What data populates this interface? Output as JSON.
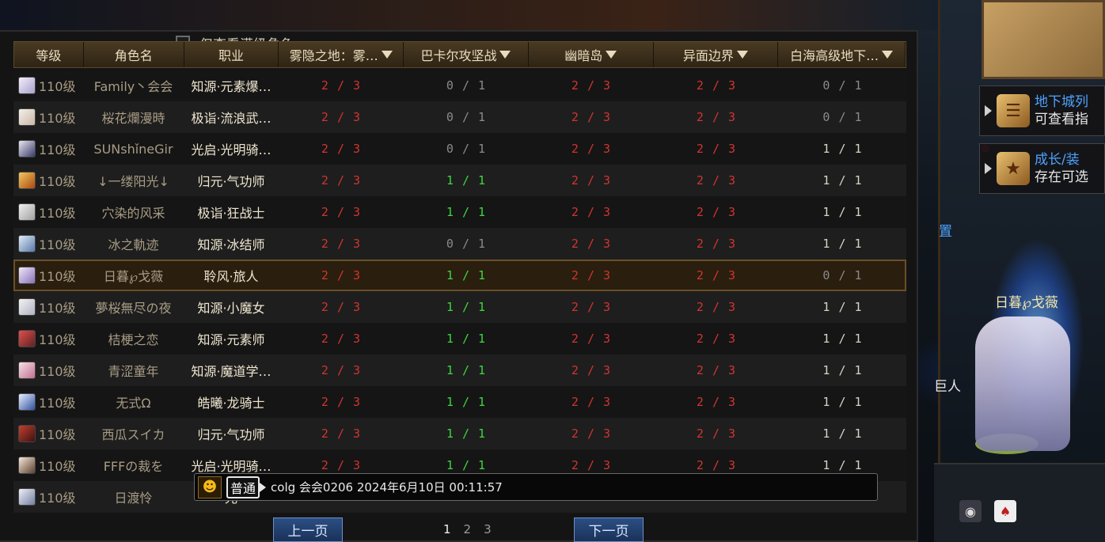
{
  "filter": {
    "label": "仅查看满级角色"
  },
  "columns": {
    "level": "等级",
    "name": "角色名",
    "job": "职业",
    "d1": "雾隐之地：雾…",
    "d2": "巴卡尔攻坚战",
    "d3": "幽暗岛",
    "d4": "异面边界",
    "d5": "白海高级地下…"
  },
  "rows": [
    {
      "level": "110级",
      "name": "Family丶会会",
      "job": "知源·元素爆…",
      "d1": "2 / 3",
      "d2": "0 / 1",
      "d3": "2 / 3",
      "d4": "2 / 3",
      "d5": "0 / 1"
    },
    {
      "level": "110级",
      "name": "桜花爛漫時",
      "job": "极诣·流浪武…",
      "d1": "2 / 3",
      "d2": "0 / 1",
      "d3": "2 / 3",
      "d4": "2 / 3",
      "d5": "0 / 1"
    },
    {
      "level": "110级",
      "name": "SUNshǐneGir",
      "job": "光启·光明骑…",
      "d1": "2 / 3",
      "d2": "0 / 1",
      "d3": "2 / 3",
      "d4": "2 / 3",
      "d5": "1 / 1"
    },
    {
      "level": "110级",
      "name": "↓一缕阳光↓",
      "job": "归元·气功师",
      "d1": "2 / 3",
      "d2": "1 / 1",
      "d3": "2 / 3",
      "d4": "2 / 3",
      "d5": "1 / 1"
    },
    {
      "level": "110级",
      "name": "穴染的风采",
      "job": "极诣·狂战士",
      "d1": "2 / 3",
      "d2": "1 / 1",
      "d3": "2 / 3",
      "d4": "2 / 3",
      "d5": "1 / 1"
    },
    {
      "level": "110级",
      "name": "冰之軌迹",
      "job": "知源·冰结师",
      "d1": "2 / 3",
      "d2": "0 / 1",
      "d3": "2 / 3",
      "d4": "2 / 3",
      "d5": "1 / 1"
    },
    {
      "level": "110级",
      "name": "日暮℘戈薇",
      "job": "聆风·旅人",
      "d1": "2 / 3",
      "d2": "1 / 1",
      "d3": "2 / 3",
      "d4": "2 / 3",
      "d5": "0 / 1"
    },
    {
      "level": "110级",
      "name": "夢桜無尽の夜",
      "job": "知源·小魔女",
      "d1": "2 / 3",
      "d2": "1 / 1",
      "d3": "2 / 3",
      "d4": "2 / 3",
      "d5": "1 / 1"
    },
    {
      "level": "110级",
      "name": "桔梗之恋",
      "job": "知源·元素师",
      "d1": "2 / 3",
      "d2": "1 / 1",
      "d3": "2 / 3",
      "d4": "2 / 3",
      "d5": "1 / 1"
    },
    {
      "level": "110级",
      "name": "青涩童年",
      "job": "知源·魔道学…",
      "d1": "2 / 3",
      "d2": "1 / 1",
      "d3": "2 / 3",
      "d4": "2 / 3",
      "d5": "1 / 1"
    },
    {
      "level": "110级",
      "name": "无式Ω",
      "job": "皓曦·龙骑士",
      "d1": "2 / 3",
      "d2": "1 / 1",
      "d3": "2 / 3",
      "d4": "2 / 3",
      "d5": "1 / 1"
    },
    {
      "level": "110级",
      "name": "西瓜スイカ",
      "job": "归元·气功师",
      "d1": "2 / 3",
      "d2": "1 / 1",
      "d3": "2 / 3",
      "d4": "2 / 3",
      "d5": "1 / 1"
    },
    {
      "level": "110级",
      "name": "FFFの裁を",
      "job": "光启·光明骑…",
      "d1": "2 / 3",
      "d2": "1 / 1",
      "d3": "2 / 3",
      "d4": "2 / 3",
      "d5": "1 / 1"
    },
    {
      "level": "110级",
      "name": "日渡怜",
      "job": "光",
      "d1": "",
      "d2": "",
      "d3": "",
      "d4": "",
      "d5": ""
    }
  ],
  "selected_row": 6,
  "chat": {
    "channel": "普通",
    "message": "colg 会会0206 2024年6月10日 00:11:57"
  },
  "pagination": {
    "prev": "上一页",
    "next": "下一页",
    "pages": [
      "1",
      "2",
      "3"
    ],
    "current": "1"
  },
  "side": {
    "notice1_title": "地下城列",
    "notice1_sub": "可查看指",
    "notice2_title": "成长/装",
    "notice2_sub": "存在可选",
    "label_left_1": "置",
    "label_left_2": "巨人",
    "character_name": "日暮℘戈薇"
  },
  "colors": {
    "incomplete": "#d2342e",
    "done": "#3ed63e",
    "zero": "#8a8a8a",
    "header_gold": "#4a3a22",
    "accent_blue": "#4da3ff"
  }
}
